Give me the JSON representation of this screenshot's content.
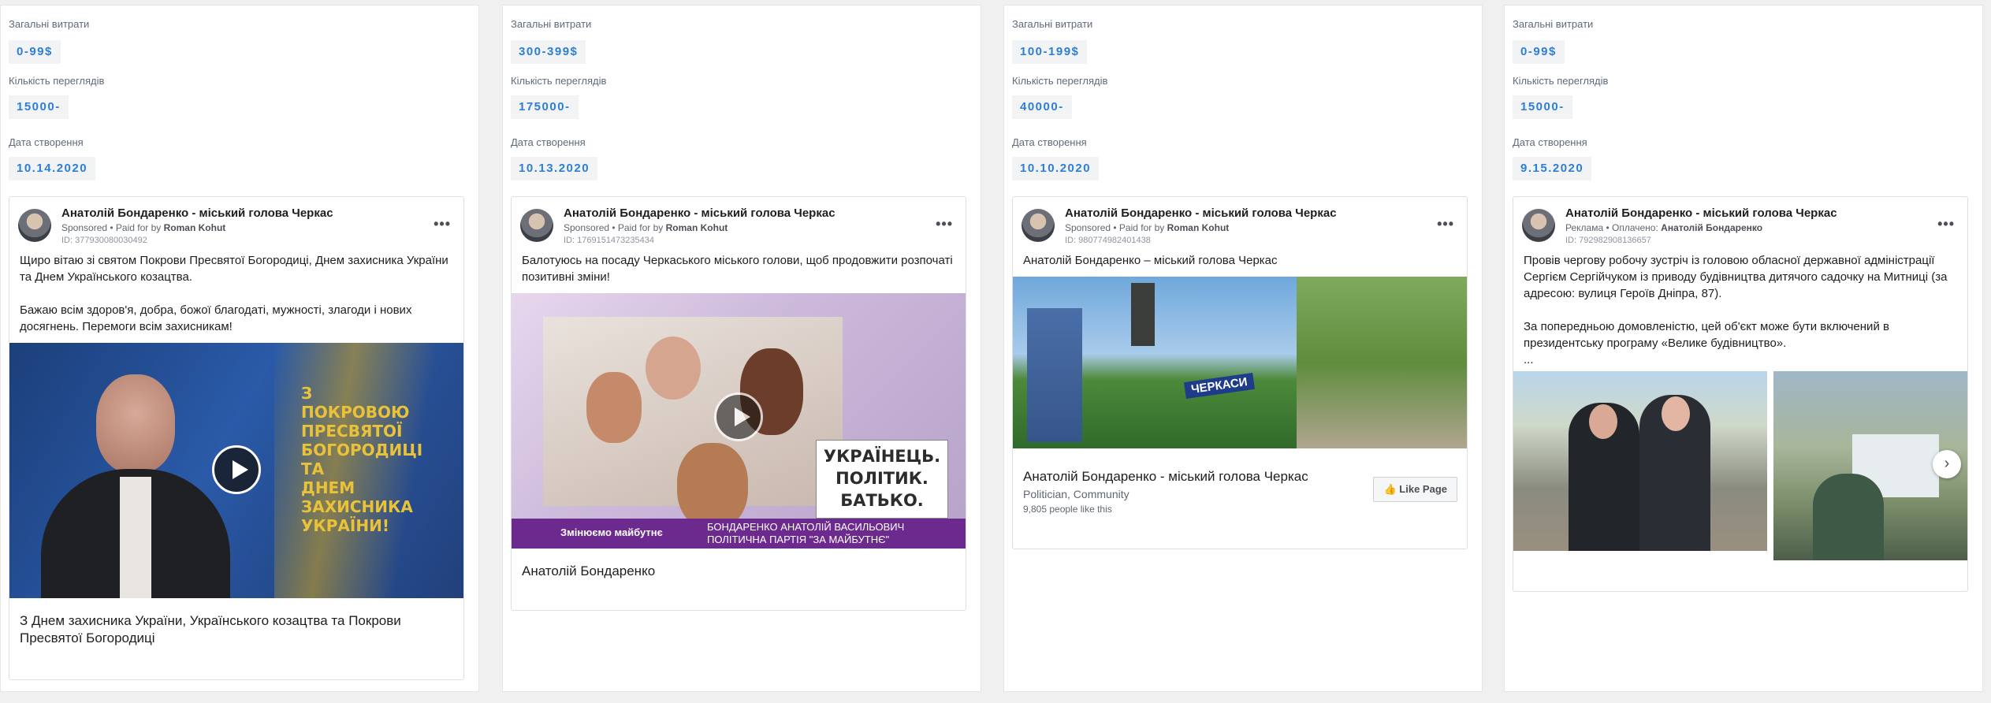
{
  "labels": {
    "spend": "Загальні витрати",
    "views": "Кількість переглядів",
    "created": "Дата створення"
  },
  "cards": [
    {
      "spend": "0-99$",
      "views": "15000-",
      "created": "10.14.2020",
      "ad": {
        "page": "Анатолій Бондаренко - міський голова Черкас",
        "sponsor_prefix": "Sponsored • Paid for by",
        "payer": "Roman Kohut",
        "id": "ID: 377930080030492",
        "text": "Щиро вітаю зі святом Покрови Пресвятої Богородиці, Днем захисника України та Днем Українського козацтва.\n\nБажаю всім здоров'я, добра, божої благодаті, мужності, злагоди і нових досягнень. Перемоги всім захисникам!",
        "overlay": "З\nПОКРОВОЮ\nПРЕСВЯТОЇ\nБОГОРОДИЦІ\nТА\nДНЕМ\nЗАХИСНИКА\nУКРАЇНИ!",
        "caption": "З Днем захисника України, Українського козацтва та Покрови Пресвятої Богородиці"
      }
    },
    {
      "spend": "300-399$",
      "views": "175000-",
      "created": "10.13.2020",
      "ad": {
        "page": "Анатолій Бондаренко - міський голова Черкас",
        "sponsor_prefix": "Sponsored • Paid for by",
        "payer": "Roman Kohut",
        "id": "ID: 1769151473235434",
        "text": "Балотуюсь на посаду Черкаського міського голови, щоб продовжити розпочаті позитивні зміни!",
        "slogan": "УКРАЇНЕЦЬ.\nПОЛІТИК.\nБАТЬКО.",
        "banner_left": "Змінюємо майбутнє",
        "banner_right": "БОНДАРЕНКО АНАТОЛІЙ ВАСИЛЬОВИЧ\nПОЛІТИЧНА ПАРТІЯ \"ЗА МАЙБУТНЄ\"",
        "caption": "Анатолій Бондаренко"
      }
    },
    {
      "spend": "100-199$",
      "views": "40000-",
      "created": "10.10.2020",
      "ad": {
        "page": "Анатолій Бондаренко - міський голова Черкас",
        "sponsor_prefix": "Sponsored • Paid for by",
        "payer": "Roman Kohut",
        "id": "ID: 980774982401438",
        "text": "Анатолій Бондаренко – міський голова Черкас",
        "sign": "ЧЕРКАСИ",
        "page_title": "Анатолій Бондаренко - міський голова Черкас",
        "page_category": "Politician, Community",
        "page_likes": "9,805 people like this",
        "like_button": "Like Page"
      }
    },
    {
      "spend": "0-99$",
      "views": "15000-",
      "created": "9.15.2020",
      "ad": {
        "page": "Анатолій Бондаренко - міський голова Черкас",
        "sponsor_prefix": "Реклама • Оплачено:",
        "payer": "Анатолій Бондаренко",
        "id": "ID: 792982908136657",
        "text": "Провів чергову робочу зустріч із головою обласної державної адміністрації Сергієм Сергійчуком із приводу будівництва дитячого садочку на Митниці (за адресою: вулиця Героїв Дніпра, 87).\n\nЗа попередньою домовленістю, цей об'єкт може бути включений в президентську програму «Велике будівництво».\n..."
      }
    }
  ]
}
